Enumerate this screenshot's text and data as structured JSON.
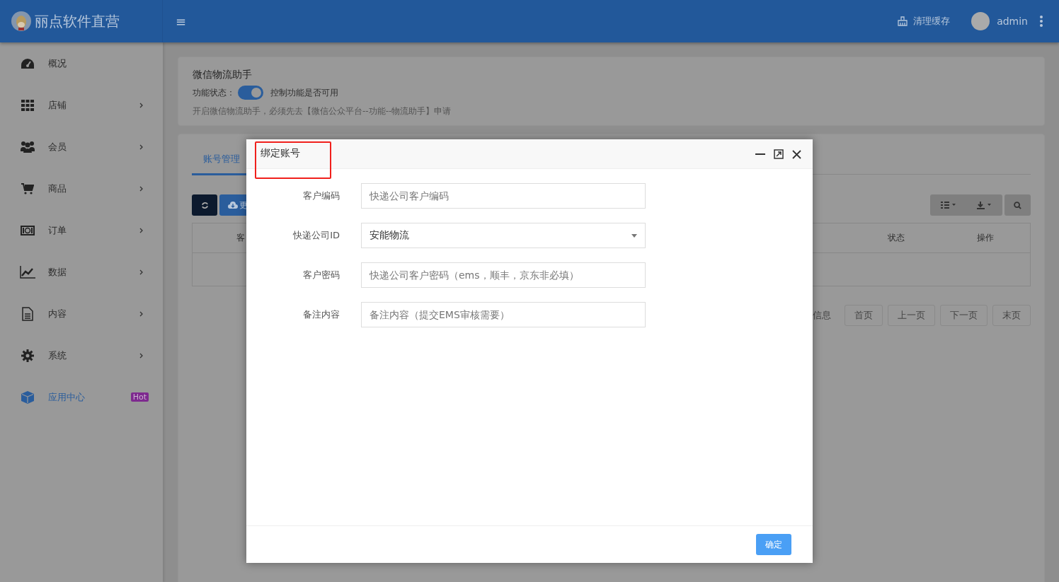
{
  "header": {
    "brand": "丽点软件直营",
    "menu_glyph": "≡",
    "clear_cache": "清理缓存",
    "user": "admin"
  },
  "sidebar": {
    "items": [
      {
        "label": "概况",
        "submenu": false,
        "selected": false
      },
      {
        "label": "店铺",
        "submenu": true,
        "selected": false
      },
      {
        "label": "会员",
        "submenu": true,
        "selected": false
      },
      {
        "label": "商品",
        "submenu": true,
        "selected": false
      },
      {
        "label": "订单",
        "submenu": true,
        "selected": false
      },
      {
        "label": "数据",
        "submenu": true,
        "selected": false
      },
      {
        "label": "内容",
        "submenu": true,
        "selected": false
      },
      {
        "label": "系统",
        "submenu": true,
        "selected": false
      },
      {
        "label": "应用中心",
        "submenu": false,
        "selected": true,
        "badge": "Hot"
      }
    ]
  },
  "feature_card": {
    "title": "微信物流助手",
    "status_label": "功能状态：",
    "toggle": {
      "on": true
    },
    "toggle_hint": "控制功能是否可用",
    "note": "开启微信物流助手，必须先去【微信公众平台--功能--物流助手】申请"
  },
  "tabs": [
    {
      "label": "账号管理",
      "selected": true
    }
  ],
  "toolbar": {
    "more_button": "更"
  },
  "table": {
    "columns": [
      "客",
      "状态",
      "操作"
    ]
  },
  "pagination": {
    "info": "信息",
    "buttons": [
      "首页",
      "上一页",
      "下一页",
      "末页"
    ]
  },
  "dialog": {
    "title": "绑定账号",
    "fields": [
      {
        "label": "客户编码",
        "kind": "input",
        "placeholder": "快递公司客户编码"
      },
      {
        "label": "快递公司ID",
        "kind": "select",
        "value": "安能物流"
      },
      {
        "label": "客户密码",
        "kind": "input",
        "placeholder": "快递公司客户密码（ems，顺丰，京东非必填）"
      },
      {
        "label": "备注内容",
        "kind": "input",
        "placeholder": "备注内容（提交EMS审核需要）"
      }
    ],
    "confirm": "确定"
  }
}
